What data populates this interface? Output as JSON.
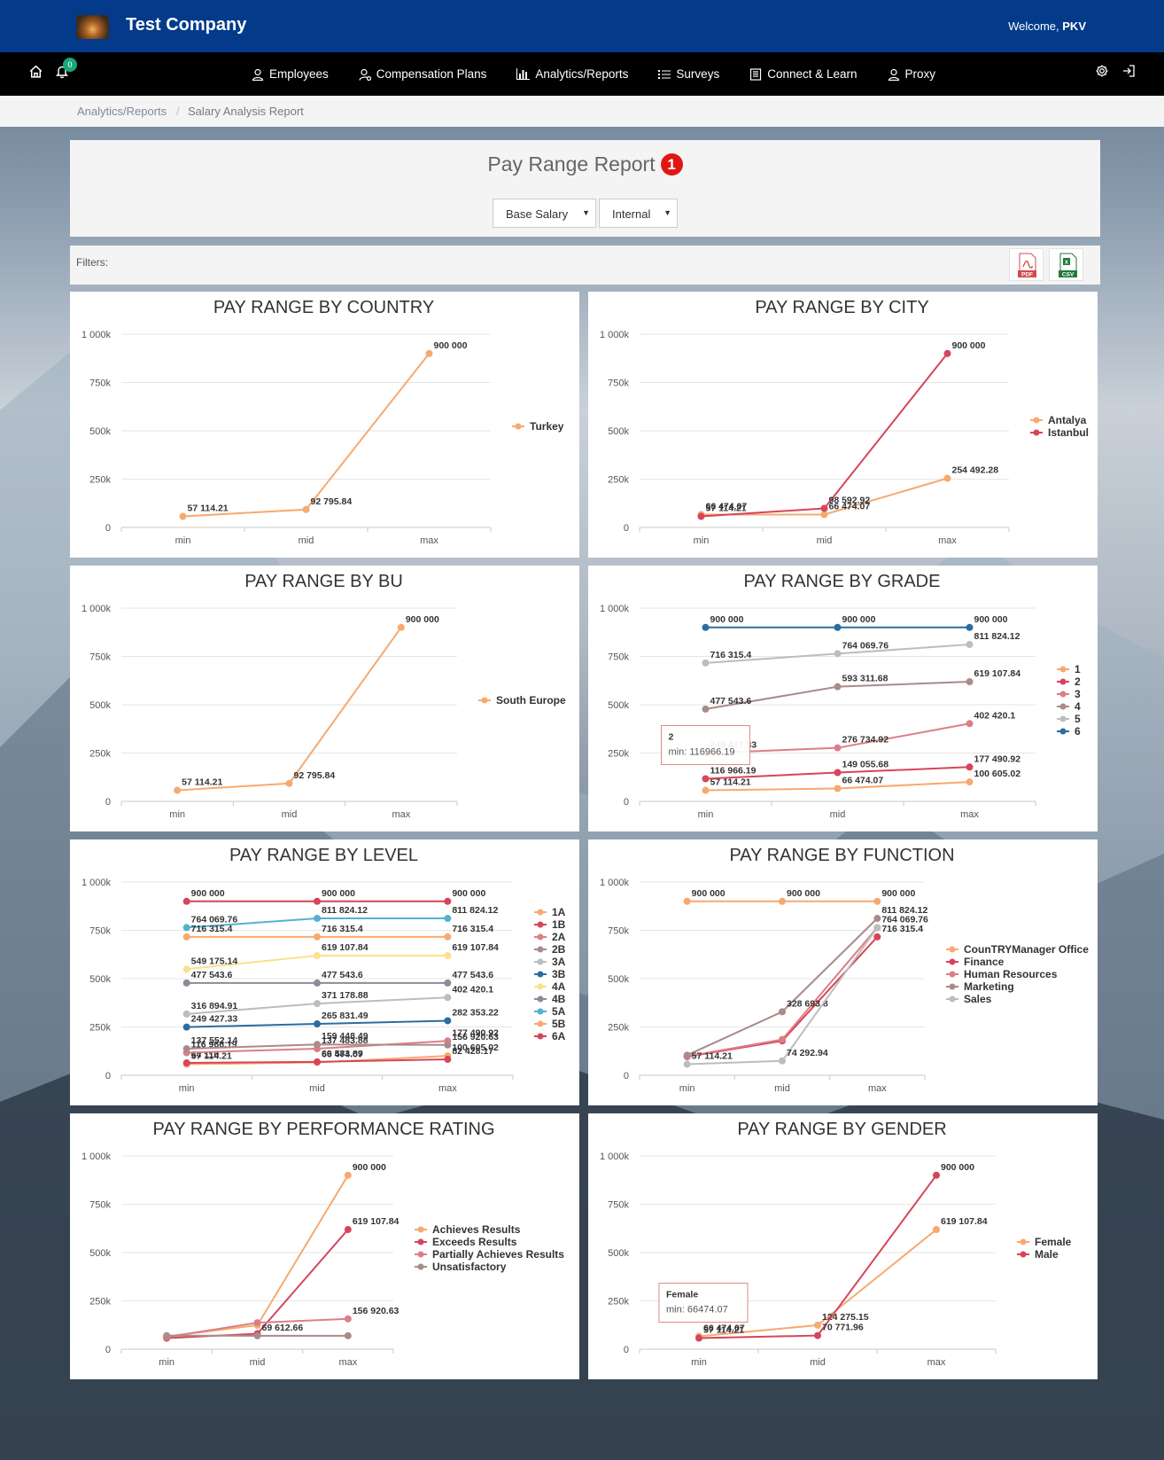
{
  "header": {
    "company": "Test Company",
    "welcome_prefix": "Welcome, ",
    "user": "PKV"
  },
  "nav": {
    "notification_count": "0",
    "items": [
      "Employees",
      "Compensation Plans",
      "Analytics/Reports",
      "Surveys",
      "Connect & Learn",
      "Proxy"
    ]
  },
  "breadcrumb": {
    "parent": "Analytics/Reports",
    "separator": "/",
    "current": "Salary Analysis Report"
  },
  "report": {
    "title": "Pay Range Report",
    "badge": "1",
    "salary_type": "Base Salary",
    "scope": "Internal",
    "filters_label": "Filters:",
    "export": [
      "PDF",
      "CSV"
    ]
  },
  "chart_data": [
    {
      "type": "line",
      "title": "PAY RANGE BY COUNTRY",
      "categories": [
        "min",
        "mid",
        "max"
      ],
      "yticks": [
        "0",
        "250k",
        "500k",
        "750k",
        "1 000k"
      ],
      "ylim": [
        0,
        1000000
      ],
      "legend": "right",
      "series": [
        {
          "name": "Turkey",
          "color": "#f7a96f",
          "values": [
            57114.21,
            92795.84,
            900000
          ],
          "labels": [
            "57 114.21",
            "92 795.84",
            "900 000"
          ]
        }
      ]
    },
    {
      "type": "line",
      "title": "PAY RANGE BY CITY",
      "categories": [
        "min",
        "mid",
        "max"
      ],
      "yticks": [
        "0",
        "250k",
        "500k",
        "750k",
        "1 000k"
      ],
      "ylim": [
        0,
        1000000
      ],
      "legend": "right",
      "series": [
        {
          "name": "Antalya",
          "color": "#f7a96f",
          "values": [
            66474.07,
            66474.07,
            254492.28
          ],
          "labels": [
            "66 474.07",
            "66 474.07",
            "254 492.28"
          ]
        },
        {
          "name": "Istanbul",
          "color": "#d6455a",
          "values": [
            57114.21,
            98592.92,
            900000
          ],
          "labels": [
            "57 114.21",
            "98 592.92",
            "900 000"
          ]
        }
      ]
    },
    {
      "type": "line",
      "title": "PAY RANGE BY BU",
      "categories": [
        "min",
        "mid",
        "max"
      ],
      "yticks": [
        "0",
        "250k",
        "500k",
        "750k",
        "1 000k"
      ],
      "ylim": [
        0,
        1000000
      ],
      "legend": "right",
      "series": [
        {
          "name": "South Europe",
          "color": "#f7a96f",
          "values": [
            57114.21,
            92795.84,
            900000
          ],
          "labels": [
            "57 114.21",
            "92 795.84",
            "900 000"
          ]
        }
      ]
    },
    {
      "type": "line",
      "title": "PAY RANGE BY GRADE",
      "categories": [
        "min",
        "mid",
        "max"
      ],
      "yticks": [
        "0",
        "250k",
        "500k",
        "750k",
        "1 000k"
      ],
      "ylim": [
        0,
        1000000
      ],
      "legend": "right",
      "tooltip": {
        "title": "2",
        "text": "min: 116966.19"
      },
      "series": [
        {
          "name": "1",
          "color": "#f7a96f",
          "values": [
            57114.21,
            66474.07,
            100605.02
          ],
          "labels": [
            "57 114.21",
            "66 474.07",
            "100 605.02"
          ]
        },
        {
          "name": "2",
          "color": "#d6455a",
          "values": [
            116966.19,
            149055.68,
            177490.92
          ],
          "labels": [
            "116 966.19",
            "149 055.68",
            "177 490.92"
          ]
        },
        {
          "name": "3",
          "color": "#db7f86",
          "values": [
            249427.33,
            276734.92,
            402420.1
          ],
          "labels": [
            "249 427.33",
            "276 734.92",
            "402 420.1"
          ]
        },
        {
          "name": "4",
          "color": "#a98b89",
          "values": [
            477543.6,
            593311.68,
            619107.84
          ],
          "labels": [
            "477 543.6",
            "593 311.68",
            "619 107.84"
          ]
        },
        {
          "name": "5",
          "color": "#bdbdbd",
          "values": [
            716315.4,
            764069.76,
            811824.12
          ],
          "labels": [
            "716 315.4",
            "764 069.76",
            "811 824.12"
          ]
        },
        {
          "name": "6",
          "color": "#2c6da0",
          "values": [
            900000,
            900000,
            900000
          ],
          "labels": [
            "900 000",
            "900 000",
            "900 000"
          ]
        }
      ]
    },
    {
      "type": "line",
      "title": "PAY RANGE BY LEVEL",
      "categories": [
        "min",
        "mid",
        "max"
      ],
      "yticks": [
        "0",
        "250k",
        "500k",
        "750k",
        "1 000k"
      ],
      "ylim": [
        0,
        1000000
      ],
      "legend": "right",
      "series": [
        {
          "name": "1A",
          "color": "#f7a96f",
          "values": [
            57114.21,
            66474.07,
            100605.02
          ],
          "labels": [
            "57 114.21",
            "66 474.07",
            "100 605.02"
          ]
        },
        {
          "name": "1B",
          "color": "#d6455a",
          "values": [
            64110.0,
            69583.89,
            82428.17
          ],
          "labels": [
            "64 110",
            "69 583.89",
            "82 428.17"
          ]
        },
        {
          "name": "2A",
          "color": "#db7f86",
          "values": [
            116966.19,
            137483.88,
            177490.92
          ],
          "labels": [
            "116 966.19",
            "137 483.88",
            "177 490.92"
          ]
        },
        {
          "name": "2B",
          "color": "#a98b89",
          "values": [
            137552.14,
            159448.49,
            156920.63
          ],
          "labels": [
            "137 552.14",
            "159 448.49",
            "156 920.63"
          ]
        },
        {
          "name": "3A",
          "color": "#bdbdbd",
          "values": [
            316894.91,
            371178.88,
            402420.1
          ],
          "labels": [
            "316 894.91",
            "371 178.88",
            "402 420.1"
          ]
        },
        {
          "name": "3B",
          "color": "#2c6da0",
          "values": [
            249427.33,
            265831.49,
            282353.22
          ],
          "labels": [
            "249 427.33",
            "265 831.49",
            "282 353.22"
          ]
        },
        {
          "name": "4A",
          "color": "#fde08a",
          "values": [
            549175.14,
            619107.84,
            619107.84
          ],
          "labels": [
            "549 175.14",
            "619 107.84",
            "619 107.84"
          ]
        },
        {
          "name": "4B",
          "color": "#8b8b99",
          "values": [
            477543.6,
            477543.6,
            477543.6
          ],
          "labels": [
            "477 543.6",
            "477 543.6",
            "477 543.6"
          ]
        },
        {
          "name": "5A",
          "color": "#52b2cf",
          "values": [
            764069.76,
            811824.12,
            811824.12
          ],
          "labels": [
            "764 069.76",
            "811 824.12",
            "811 824.12"
          ]
        },
        {
          "name": "5B",
          "color": "#f7a96f",
          "values": [
            716315.4,
            716315.4,
            716315.4
          ],
          "labels": [
            "716 315.4",
            "716 315.4",
            "716 315.4"
          ]
        },
        {
          "name": "6A",
          "color": "#d6455a",
          "values": [
            900000,
            900000,
            900000
          ],
          "labels": [
            "900 000",
            "900 000",
            "900 000"
          ]
        }
      ]
    },
    {
      "type": "line",
      "title": "PAY RANGE BY FUNCTION",
      "categories": [
        "min",
        "mid",
        "max"
      ],
      "yticks": [
        "0",
        "250k",
        "500k",
        "750k",
        "1 000k"
      ],
      "ylim": [
        0,
        1000000
      ],
      "legend": "right",
      "series": [
        {
          "name": "CounTRYManager Office",
          "color": "#f7a96f",
          "values": [
            900000,
            900000,
            900000
          ],
          "labels": [
            "900 000",
            "900 000",
            "900 000"
          ]
        },
        {
          "name": "Finance",
          "color": "#d6455a",
          "values": [
            96000,
            178000,
            716315.4
          ],
          "labels": [
            "",
            "",
            "716 315.4"
          ]
        },
        {
          "name": "Human Resources",
          "color": "#db7f86",
          "values": [
            98000,
            185000,
            764069.76
          ],
          "labels": [
            "",
            "",
            "764 069.76"
          ]
        },
        {
          "name": "Marketing",
          "color": "#a98b89",
          "values": [
            104000,
            328693.8,
            811824.12
          ],
          "labels": [
            "",
            "328 693.8",
            "811 824.12"
          ]
        },
        {
          "name": "Sales",
          "color": "#bdbdbd",
          "values": [
            57114.21,
            74292.94,
            764069.76
          ],
          "labels": [
            "57 114.21",
            "74 292.94",
            ""
          ]
        }
      ]
    },
    {
      "type": "line",
      "title": "PAY RANGE BY PERFORMANCE RATING",
      "categories": [
        "min",
        "mid",
        "max"
      ],
      "yticks": [
        "0",
        "250k",
        "500k",
        "750k",
        "1 000k"
      ],
      "ylim": [
        0,
        1000000
      ],
      "legend": "right",
      "series": [
        {
          "name": "Achieves Results",
          "color": "#f7a96f",
          "values": [
            66000,
            124000,
            900000
          ],
          "labels": [
            "",
            "",
            "900 000"
          ]
        },
        {
          "name": "Exceeds Results",
          "color": "#d6455a",
          "values": [
            57114.21,
            80000,
            619107.84
          ],
          "labels": [
            "",
            "",
            "619 107.84"
          ]
        },
        {
          "name": "Partially Achieves Results",
          "color": "#db7f86",
          "values": [
            63000,
            137000,
            156920.63
          ],
          "labels": [
            "",
            "",
            "156 920.63"
          ]
        },
        {
          "name": "Unsatisfactory",
          "color": "#a98b89",
          "values": [
            70000,
            69612.66,
            69612.66
          ],
          "labels": [
            "",
            "69 612.66",
            ""
          ]
        }
      ]
    },
    {
      "type": "line",
      "title": "PAY RANGE BY GENDER",
      "categories": [
        "min",
        "mid",
        "max"
      ],
      "yticks": [
        "0",
        "250k",
        "500k",
        "750k",
        "1 000k"
      ],
      "ylim": [
        0,
        1000000
      ],
      "legend": "right",
      "tooltip": {
        "title": "Female",
        "text": "min: 66474.07"
      },
      "series": [
        {
          "name": "Female",
          "color": "#f7a96f",
          "values": [
            66474.07,
            124275.15,
            619107.84
          ],
          "labels": [
            "66 474.07",
            "124 275.15",
            "619 107.84"
          ]
        },
        {
          "name": "Male",
          "color": "#d6455a",
          "values": [
            57114.21,
            70771.96,
            900000
          ],
          "labels": [
            "57 114.21",
            "70 771.96",
            "900 000"
          ]
        }
      ]
    }
  ]
}
